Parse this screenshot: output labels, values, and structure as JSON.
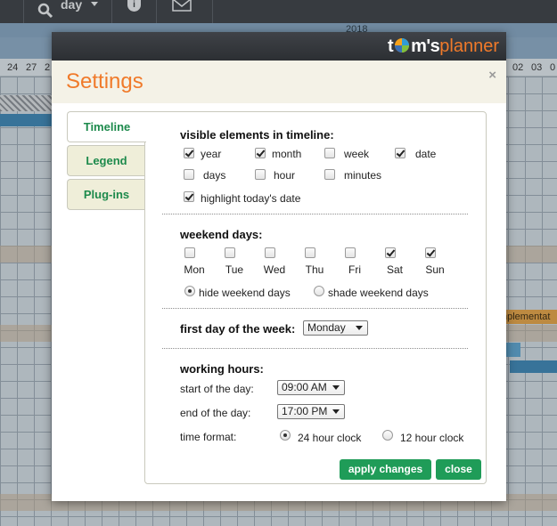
{
  "background": {
    "toolbar": {
      "view_select": "day"
    },
    "year": "2018",
    "days_left": [
      "24",
      "27",
      "2"
    ],
    "days_right": [
      "02",
      "03",
      "0"
    ],
    "task_label": "nplementat"
  },
  "logo": {
    "part_t": "t",
    "part_m": "m's",
    "part_planner": "planner"
  },
  "dialog": {
    "title": "Settings",
    "close_symbol": "×",
    "tabs": [
      {
        "label": "Timeline",
        "active": true
      },
      {
        "label": "Legend",
        "active": false
      },
      {
        "label": "Plug-ins",
        "active": false
      }
    ]
  },
  "visible_elements": {
    "title": "visible elements in timeline:",
    "options": [
      {
        "label": "year",
        "checked": true
      },
      {
        "label": "month",
        "checked": true
      },
      {
        "label": "week",
        "checked": false
      },
      {
        "label": "date",
        "checked": true
      },
      {
        "label": "days",
        "checked": false
      },
      {
        "label": "hour",
        "checked": false
      },
      {
        "label": "minutes",
        "checked": false
      },
      {
        "label": "highlight today's date",
        "checked": true
      }
    ]
  },
  "weekend_days": {
    "title": "weekend days:",
    "days": [
      {
        "label": "Mon",
        "checked": false
      },
      {
        "label": "Tue",
        "checked": false
      },
      {
        "label": "Wed",
        "checked": false
      },
      {
        "label": "Thu",
        "checked": false
      },
      {
        "label": "Fri",
        "checked": false
      },
      {
        "label": "Sat",
        "checked": true
      },
      {
        "label": "Sun",
        "checked": true
      }
    ],
    "mode_options": [
      {
        "label": "hide weekend days",
        "selected": true
      },
      {
        "label": "shade weekend days",
        "selected": false
      }
    ]
  },
  "first_day": {
    "label": "first day of the week:",
    "value": "Monday"
  },
  "working_hours": {
    "title": "working hours:",
    "start_label": "start of the day:",
    "start_value": "09:00 AM",
    "end_label": "end of the day:",
    "end_value": "17:00 PM",
    "time_format_label": "time format:",
    "time_format_options": [
      {
        "label": "24 hour clock",
        "selected": true
      },
      {
        "label": "12 hour clock",
        "selected": false
      }
    ]
  },
  "buttons": {
    "apply": "apply changes",
    "close": "close"
  },
  "colors": {
    "accent_orange": "#f07a2a",
    "tab_green": "#1d8a4c",
    "button_green": "#1f9c58"
  }
}
